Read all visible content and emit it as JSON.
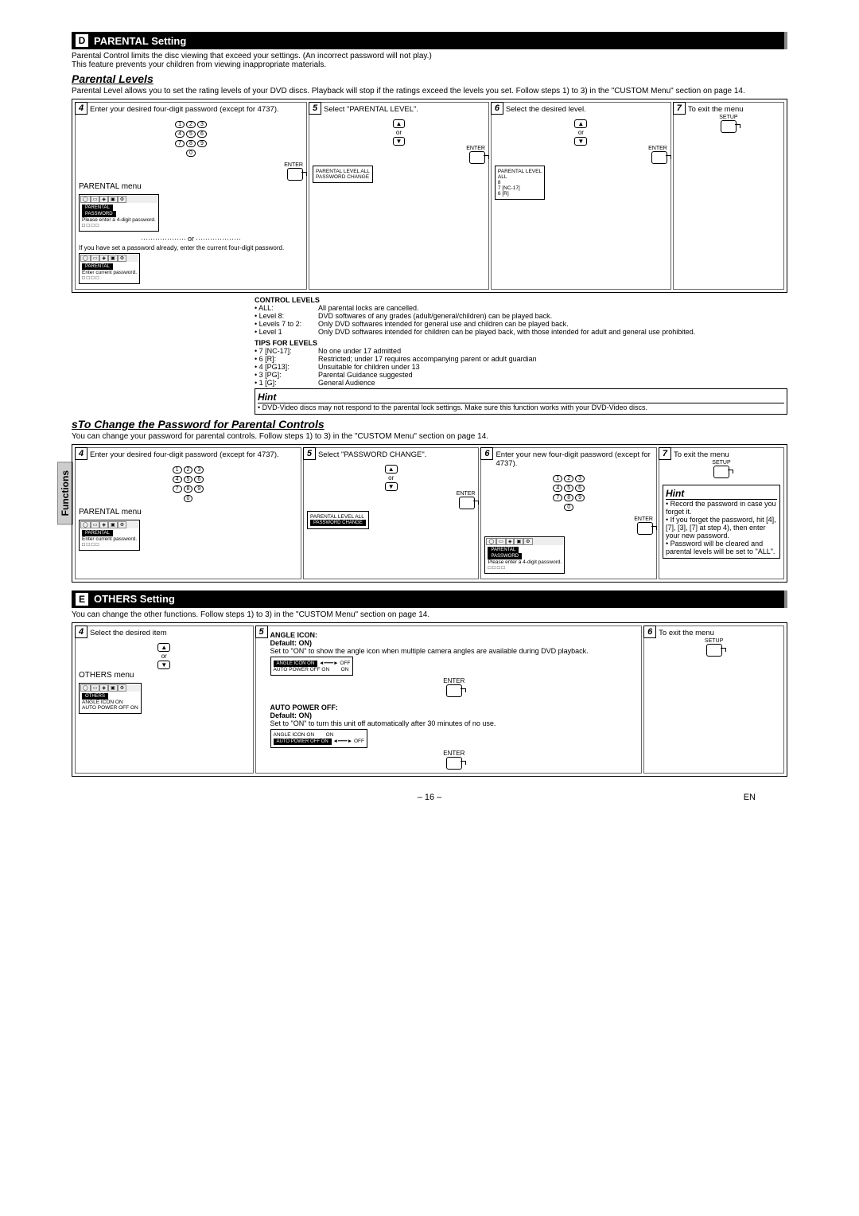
{
  "side_tab": "Functions",
  "sectionD": {
    "letter": "D",
    "title": "PARENTAL Setting",
    "intro1": "Parental Control limits the disc viewing that exceed your settings. (An incorrect password will not play.)",
    "intro2": "This feature prevents your children from viewing inappropriate materials.",
    "sub": "Parental Levels",
    "sub_desc": "Parental Level allows you to set the rating levels of your DVD discs. Playback will stop if the ratings exceed the levels you set. Follow steps 1) to 3) in the \"CUSTOM Menu\" section on page 14.",
    "steps": {
      "4": "Enter your desired four-digit password (except for 4737).",
      "4_menu": "PARENTAL menu",
      "4_or": "or",
      "4_if": "If you have set a password already, enter the current four-digit password.",
      "5": "Select \"PARENTAL LEVEL\".",
      "5_menu": {
        "l1": "PARENTAL LEVEL    ALL",
        "l2": "PASSWORD CHANGE"
      },
      "6": "Select the desired level.",
      "6_menu": {
        "title": "PARENTAL LEVEL",
        "o1": "ALL",
        "o2": "8",
        "o3": "7 [NC-17]",
        "o4": "6 [R]"
      },
      "7": "To exit the menu",
      "enter": "ENTER",
      "setup": "SETUP",
      "or": "or"
    },
    "control": {
      "title": "CONTROL LEVELS",
      "all": {
        "l": "• ALL:",
        "d": "All parental locks are cancelled."
      },
      "l8": {
        "l": "• Level 8:",
        "d": "DVD softwares of any grades (adult/general/children) can be played back."
      },
      "l72": {
        "l": "• Levels 7 to 2:",
        "d": "Only DVD softwares intended for general use and children can be played back."
      },
      "l1": {
        "l": "• Level 1",
        "d": "Only DVD softwares intended for children can be played back, with those intended for adult and general use prohibited."
      }
    },
    "tips": {
      "title": "TIPS FOR LEVELS",
      "r": [
        {
          "l": "• 7 [NC-17]:",
          "d": "No one under 17 admitted"
        },
        {
          "l": "• 6 [R]:",
          "d": "Restricted; under 17 requires accompanying parent or adult guardian"
        },
        {
          "l": "• 4 [PG13]:",
          "d": "Unsuitable for children under 13"
        },
        {
          "l": "• 3 [PG]:",
          "d": "Parental Guidance suggested"
        },
        {
          "l": "• 1 [G]:",
          "d": "General Audience"
        }
      ]
    },
    "hint": {
      "title": "Hint",
      "body": "• DVD-Video discs may not respond to the parental lock settings. Make sure this function works with your DVD-Video discs."
    }
  },
  "password": {
    "title": "sTo Change the Password for Parental Controls",
    "intro": "You can change your password for parental controls. Follow steps 1) to 3) in the \"CUSTOM Menu\" section on page 14.",
    "steps": {
      "4": "Enter your desired four-digit password (except for 4737).",
      "4_menu": "PARENTAL menu",
      "5": "Select \"PASSWORD CHANGE\".",
      "5_menu": {
        "l1": "PARENTAL LEVEL    ALL",
        "l2": "PASSWORD CHANGE"
      },
      "6": "Enter your new four-digit password (except for 4737).",
      "7": "To exit the menu"
    },
    "screen": {
      "title": "PARENTAL",
      "line1": "PASSWORD",
      "line2": "Please enter a 4-digit password.",
      "boxes": "□ □ □ □",
      "line3": "Enter current password."
    },
    "hint": {
      "title": "Hint",
      "b1": "• Record the password in case you forget it.",
      "b2": "• If you forget the password, hit [4], [7], [3], [7] at step 4), then enter your new password.",
      "b3": "• Password will be cleared and parental levels will be set to \"ALL\"."
    }
  },
  "sectionE": {
    "letter": "E",
    "title": "OTHERS Setting",
    "intro": "You can change the other functions. Follow steps 1) to 3) in the \"CUSTOM Menu\" section on page 14.",
    "steps": {
      "4": "Select the desired item",
      "4_menu": "OTHERS menu",
      "5_angle": {
        "title": "ANGLE ICON:",
        "def": "Default: ON)",
        "desc": "Set to \"ON\" to show the angle icon when multiple camera angles are available during DVD playback.",
        "m1": "ANGLE ICON      ON",
        "m2": "AUTO POWER OFF  ON",
        "o1": "OFF",
        "o2": "ON"
      },
      "5_auto": {
        "title": "AUTO POWER OFF:",
        "def": "Default: ON)",
        "desc": "Set to \"ON\" to turn this unit off automatically after 30 minutes of no use.",
        "m1": "ANGLE ICON      ON",
        "m2": "AUTO POWER OFF  ON",
        "o1": "ON",
        "o2": "OFF"
      },
      "6": "To exit the menu",
      "enter": "ENTER",
      "setup": "SETUP",
      "or": "or"
    }
  },
  "footer": {
    "page": "– 16 –",
    "lang": "EN"
  }
}
